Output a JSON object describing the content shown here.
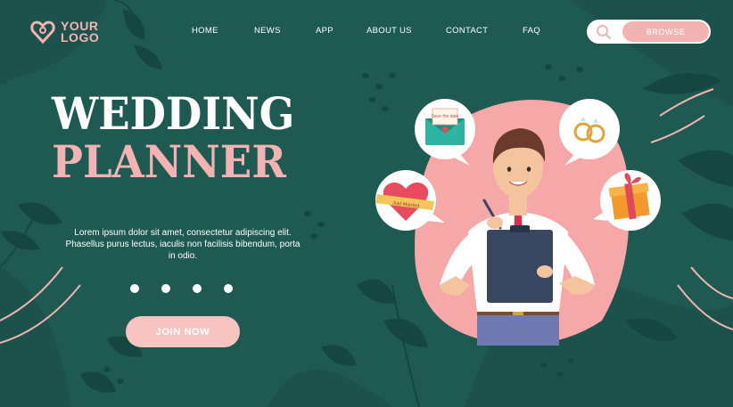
{
  "logo": {
    "line1": "YOUR",
    "line2": "LOGO",
    "icon": "heart-icon"
  },
  "nav": {
    "items": [
      "HOME",
      "NEWS",
      "APP",
      "ABOUT US",
      "CONTACT",
      "FAQ"
    ]
  },
  "search": {
    "icon": "search-icon",
    "button_label": "BROWSE"
  },
  "hero": {
    "title_line1": "WEDDING",
    "title_line2": "PLANNER",
    "description": "Lorem ipsum dolor sit amet, consectetur adipiscing elit. Phasellus purus lectus, iaculis non facilisis bibendum, porta in odio.",
    "cta_label": "JOIN NOW",
    "slider_dots": 4
  },
  "illustration": {
    "envelope_text": "Save the date",
    "heart_ribbon_text": "Just Married",
    "icons": [
      "envelope-icon",
      "rings-icon",
      "heart-ribbon-icon",
      "gift-icon"
    ]
  },
  "colors": {
    "background": "#1f5a52",
    "accent": "#f4b3b3",
    "text": "#ffffff"
  }
}
